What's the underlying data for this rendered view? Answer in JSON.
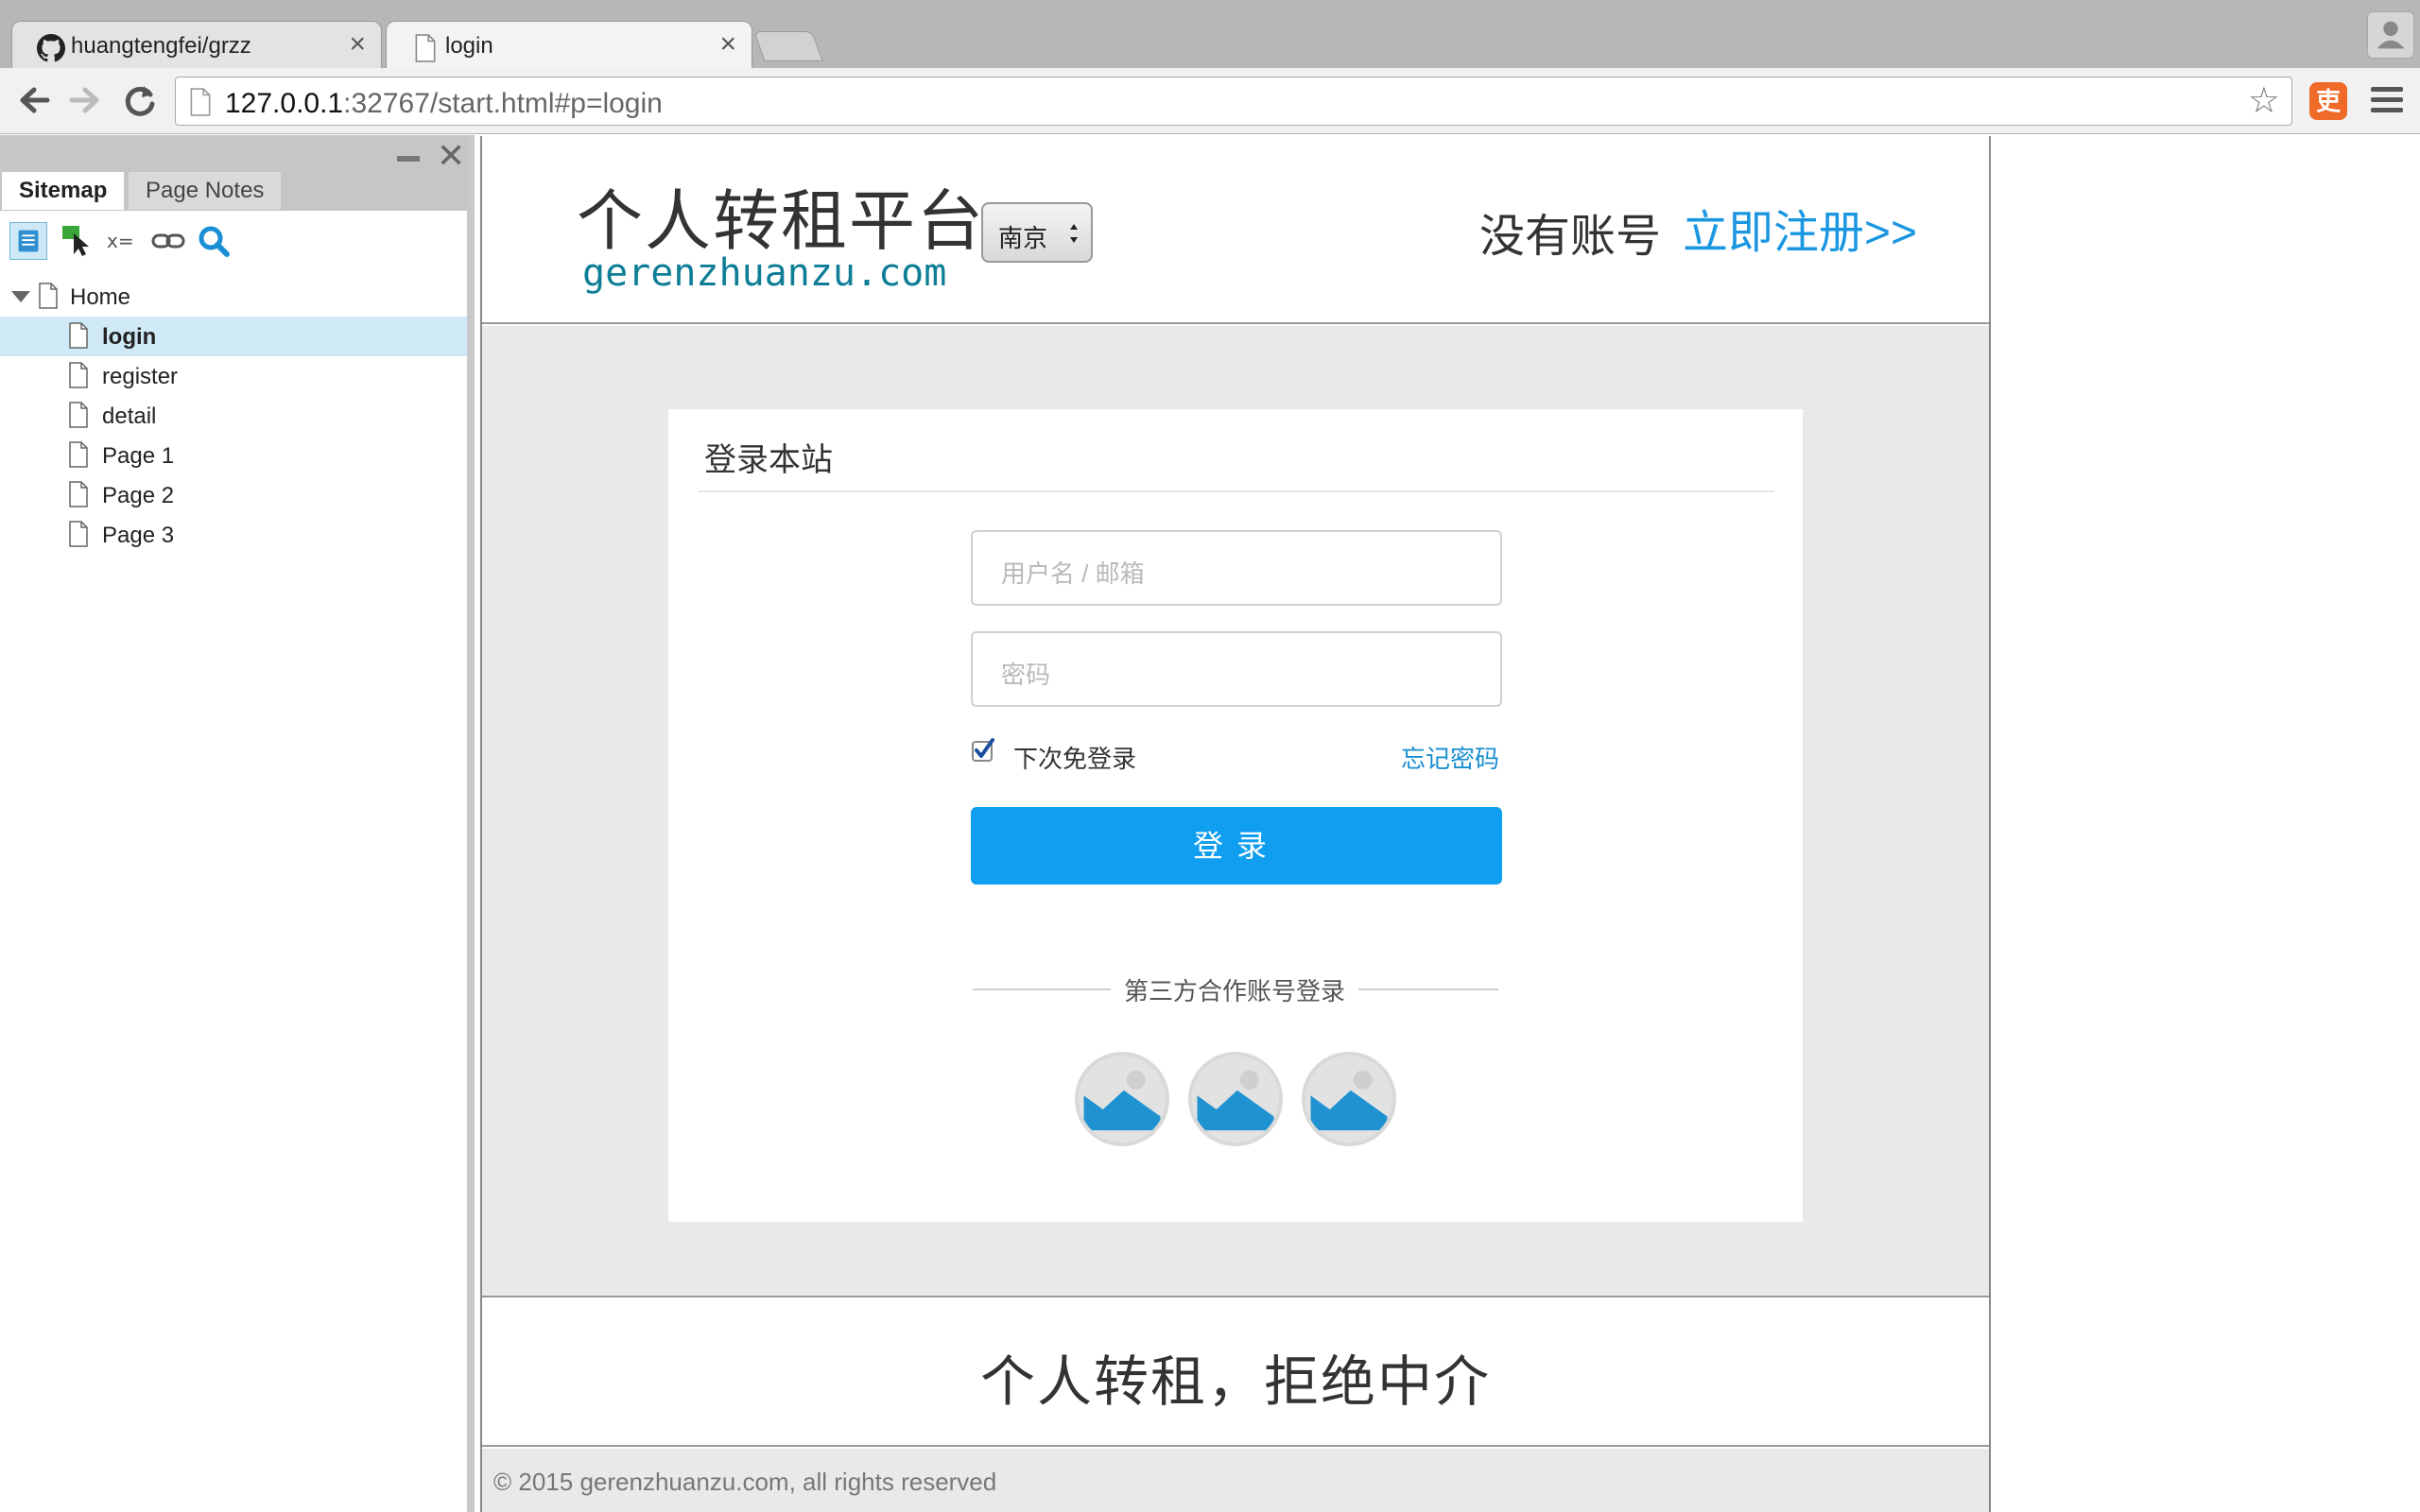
{
  "browser": {
    "tabs": [
      {
        "title": "huangtengfei/grzz",
        "close": "×"
      },
      {
        "title": "login",
        "close": "×"
      }
    ],
    "url_host": "127.0.0.1",
    "url_rest": ":32767/start.html#p=login",
    "extension_label": "吏"
  },
  "sidebar": {
    "tabs": [
      "Sitemap",
      "Page Notes"
    ],
    "tree": [
      {
        "label": "Home",
        "level": 0
      },
      {
        "label": "login",
        "level": 1,
        "selected": true
      },
      {
        "label": "register",
        "level": 1
      },
      {
        "label": "detail",
        "level": 1
      },
      {
        "label": "Page 1",
        "level": 1
      },
      {
        "label": "Page 2",
        "level": 1
      },
      {
        "label": "Page 3",
        "level": 1
      }
    ]
  },
  "site": {
    "logo_cn": "个人转租平台",
    "logo_en": "gerenzhuanzu.com",
    "city": "南京",
    "no_account": "没有账号",
    "register_link": "立即注册>>",
    "card_title": "登录本站",
    "username_placeholder": "用户名 / 邮箱",
    "password_placeholder": "密码",
    "remember_label": "下次免登录",
    "remember_checked": true,
    "forgot_label": "忘记密码",
    "login_button": "登录",
    "third_party_label": "第三方合作账号登录",
    "slogan": "个人转租，拒绝中介",
    "copyright": "© 2015 gerenzhuanzu.com, all rights reserved"
  },
  "colors": {
    "accent": "#0f9ef0",
    "link": "#1a97e0",
    "logo_en": "#0e7e96",
    "page_bg": "#e9e9e9"
  }
}
